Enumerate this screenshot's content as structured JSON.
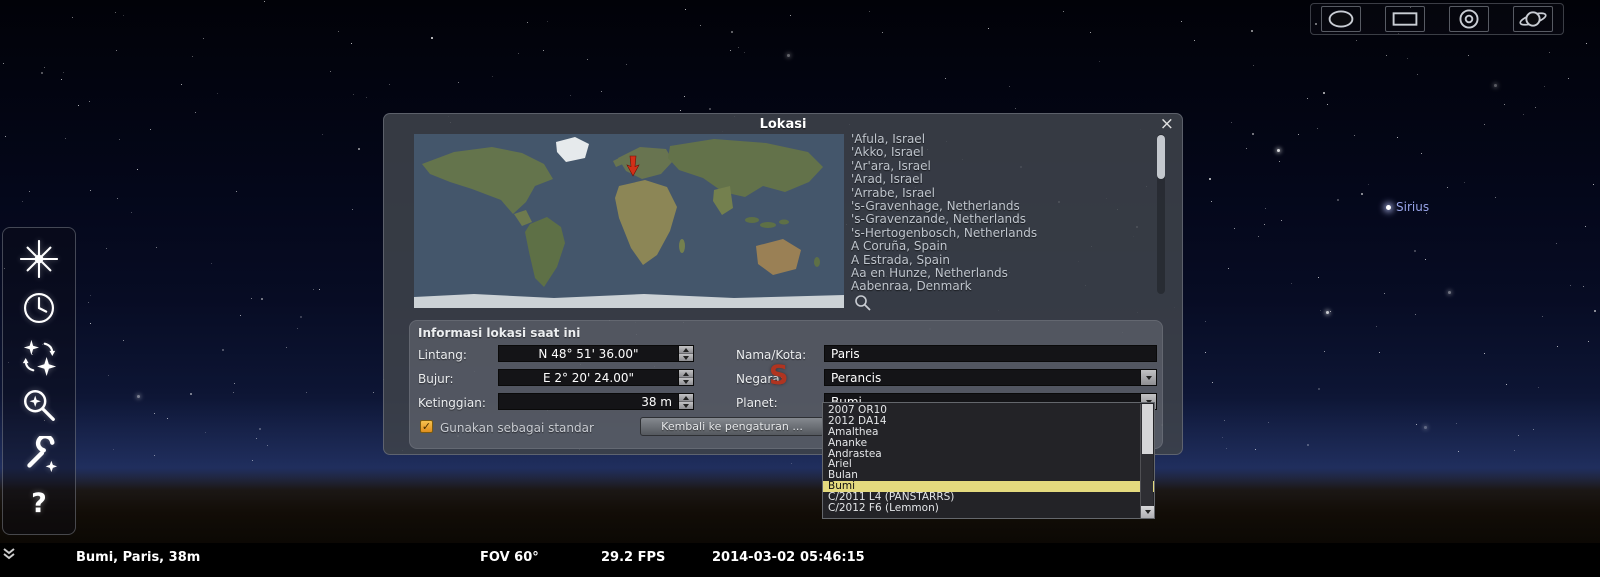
{
  "sky": {
    "star_label": "Sirius",
    "cardinal_south": "S"
  },
  "top_toolbar": {
    "buttons": [
      {
        "icon": "oval-toggle-icon"
      },
      {
        "icon": "rectangle-toggle-icon"
      },
      {
        "icon": "rings-toggle-icon"
      },
      {
        "icon": "saturn-toggle-icon"
      }
    ]
  },
  "left_toolbar": {
    "buttons": [
      {
        "icon": "location-starburst-icon"
      },
      {
        "icon": "clock-icon"
      },
      {
        "icon": "sky-viewing-options-icon"
      },
      {
        "icon": "search-magnifier-icon"
      },
      {
        "icon": "wrench-icon"
      },
      {
        "icon": "help-icon",
        "glyph": "?"
      }
    ]
  },
  "location_dialog": {
    "title": "Lokasi",
    "close_glyph": "×",
    "city_list": [
      "'Afula, Israel",
      "'Akko, Israel",
      "'Ar'ara, Israel",
      "'Arad, Israel",
      "'Arrabe, Israel",
      "'s-Gravenhage, Netherlands",
      "'s-Gravenzande, Netherlands",
      "'s-Hertogenbosch, Netherlands",
      "A Coruña, Spain",
      "A Estrada, Spain",
      "Aa en Hunze, Netherlands",
      "Aabenraa, Denmark"
    ],
    "section_title": "Informasi lokasi saat ini",
    "latitude": {
      "label": "Lintang:",
      "value": "N 48° 51' 36.00\""
    },
    "longitude": {
      "label": "Bujur:",
      "value": "E 2° 20' 24.00\""
    },
    "altitude": {
      "label": "Ketinggian:",
      "value": "38 m"
    },
    "name_city": {
      "label": "Nama/Kota:",
      "value": "Paris"
    },
    "country": {
      "label": "Negara:",
      "value": "Perancis"
    },
    "planet": {
      "label": "Planet:",
      "value": "Bumi"
    },
    "default_checkbox_label": "Gunakan sebagai standar",
    "checkbox_glyph": "✓",
    "reset_button_label": "Kembali ke pengaturan ...",
    "planet_dropdown": {
      "options": [
        "2007 OR10",
        "2012 DA14",
        "Amalthea",
        "Ananke",
        "Andrastea",
        "Ariel",
        "Bulan",
        "Bumi",
        "C/2011 L4 (PANSTARRS)",
        "C/2012 F6 (Lemmon)"
      ],
      "selected_index": 7
    }
  },
  "status_bar": {
    "location": "Bumi, Paris, 38m",
    "fov": "FOV 60°",
    "fps": "29.2 FPS",
    "date": "2014-03-02",
    "time": "05:46:15"
  },
  "colors": {
    "dropdown_highlight": "#e4da7e",
    "checkbox_orange": "#eea42e",
    "map_marker_red": "#d23018",
    "star_label_blue": "#98a4e8"
  }
}
